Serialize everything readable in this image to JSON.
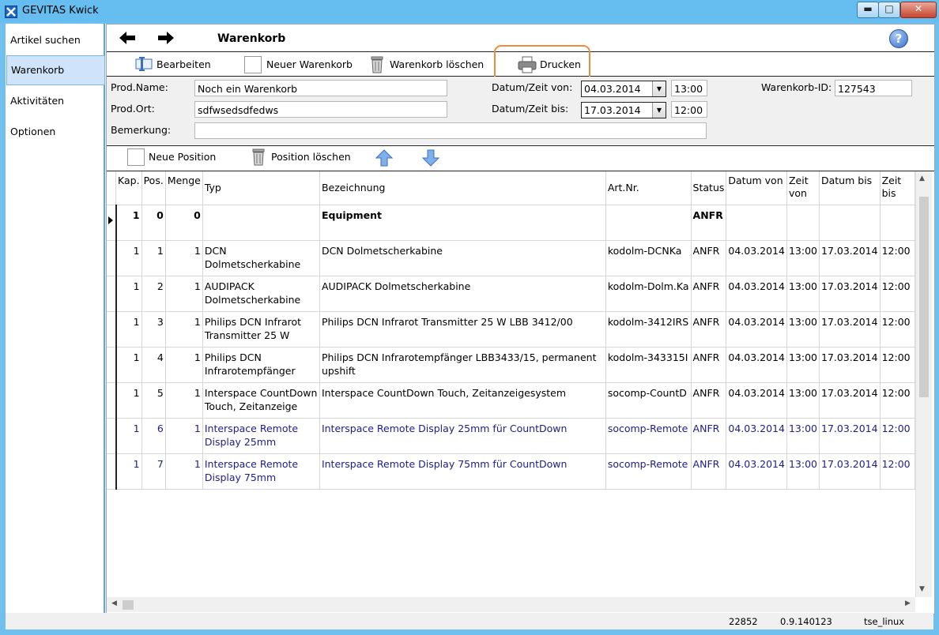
{
  "window": {
    "title": "GEVITAS Kwick",
    "min": "▬",
    "max": "□",
    "close": "✕"
  },
  "sidebar": {
    "items": [
      {
        "label": "Artikel suchen"
      },
      {
        "label": "Warenkorb"
      },
      {
        "label": "Aktivitäten"
      },
      {
        "label": "Optionen"
      }
    ]
  },
  "nav": {
    "back": "🡄",
    "forward": "🡆",
    "title": "Warenkorb",
    "help": "?"
  },
  "toolbar": {
    "edit": "Bearbeiten",
    "new_cart": "Neuer Warenkorb",
    "delete_cart": "Warenkorb löschen",
    "print": "Drucken"
  },
  "form": {
    "prod_name_label": "Prod.Name:",
    "prod_name_value": "Noch ein Warenkorb",
    "prod_ort_label": "Prod.Ort:",
    "prod_ort_value": "sdfwsedsdfedws",
    "bemerkung_label": "Bemerkung:",
    "bemerkung_value": "",
    "datum_von_label": "Datum/Zeit von:",
    "datum_von_value": "04.03.2014",
    "zeit_von_value": "13:00",
    "datum_bis_label": "Datum/Zeit bis:",
    "datum_bis_value": "17.03.2014",
    "zeit_bis_value": "12:00",
    "warenkorb_id_label": "Warenkorb-ID:",
    "warenkorb_id_value": "127543"
  },
  "positions_toolbar": {
    "new": "Neue Position",
    "delete": "Position löschen"
  },
  "table": {
    "columns": [
      "Kap.",
      "Pos.",
      "Menge",
      "Typ",
      "Bezeichnung",
      "Art.Nr.",
      "Status",
      "Datum von",
      "Zeit von",
      "Datum bis",
      "Zeit bis"
    ],
    "rows": [
      {
        "kap": "1",
        "pos": "0",
        "menge": "0",
        "typ": "",
        "bez": "Equipment",
        "art": "",
        "status": "ANFR",
        "dvon": "",
        "zvon": "",
        "dbis": "",
        "zbis": "",
        "style": "bold"
      },
      {
        "kap": "1",
        "pos": "1",
        "menge": "1",
        "typ": "DCN Dolmetscherkabine",
        "bez": "DCN Dolmetscherkabine",
        "art": "kodolm-DCNKa",
        "status": "ANFR",
        "dvon": "04.03.2014",
        "zvon": "13:00",
        "dbis": "17.03.2014",
        "zbis": "12:00",
        "style": ""
      },
      {
        "kap": "1",
        "pos": "2",
        "menge": "1",
        "typ": "AUDIPACK Dolmetscherkabine",
        "bez": "AUDIPACK Dolmetscherkabine",
        "art": "kodolm-Dolm.Ka",
        "status": "ANFR",
        "dvon": "04.03.2014",
        "zvon": "13:00",
        "dbis": "17.03.2014",
        "zbis": "12:00",
        "style": ""
      },
      {
        "kap": "1",
        "pos": "3",
        "menge": "1",
        "typ": "Philips DCN Infrarot Transmitter 25 W",
        "bez": "Philips DCN Infrarot Transmitter 25 W LBB 3412/00",
        "art": "kodolm-3412IRS",
        "status": "ANFR",
        "dvon": "04.03.2014",
        "zvon": "13:00",
        "dbis": "17.03.2014",
        "zbis": "12:00",
        "style": ""
      },
      {
        "kap": "1",
        "pos": "4",
        "menge": "1",
        "typ": "Philips DCN Infrarotempfänger",
        "bez": "Philips DCN Infrarotempfänger LBB3433/15, permanent upshift",
        "art": "kodolm-343315I",
        "status": "ANFR",
        "dvon": "04.03.2014",
        "zvon": "13:00",
        "dbis": "17.03.2014",
        "zbis": "12:00",
        "style": ""
      },
      {
        "kap": "1",
        "pos": "5",
        "menge": "1",
        "typ": "Interspace CountDown Touch, Zeitanzeige",
        "bez": "Interspace CountDown Touch, Zeitanzeigesystem",
        "art": "socomp-CountD",
        "status": "ANFR",
        "dvon": "04.03.2014",
        "zvon": "13:00",
        "dbis": "17.03.2014",
        "zbis": "12:00",
        "style": ""
      },
      {
        "kap": "1",
        "pos": "6",
        "menge": "1",
        "typ": "Interspace Remote Display 25mm",
        "bez": "Interspace Remote Display 25mm für CountDown",
        "art": "socomp-Remote",
        "status": "ANFR",
        "dvon": "04.03.2014",
        "zvon": "13:00",
        "dbis": "17.03.2014",
        "zbis": "12:00",
        "style": "blue"
      },
      {
        "kap": "1",
        "pos": "7",
        "menge": "1",
        "typ": "Interspace Remote Display 75mm",
        "bez": "Interspace Remote Display 75mm für CountDown",
        "art": "socomp-Remote",
        "status": "ANFR",
        "dvon": "04.03.2014",
        "zvon": "13:00",
        "dbis": "17.03.2014",
        "zbis": "12:00",
        "style": "blue"
      }
    ]
  },
  "status": {
    "count": "22852",
    "version": "0.9.140123",
    "host": "tse_linux"
  },
  "icons": {
    "back": "arrow-left-icon",
    "forward": "arrow-right-icon",
    "help": "help-icon",
    "edit": "edit-icon",
    "new_cart": "blank-document-icon",
    "delete_cart": "trash-icon",
    "print": "printer-icon",
    "up": "arrow-up-icon",
    "down": "arrow-down-icon"
  },
  "colors": {
    "titlebar": "#66bdf0",
    "highlight": "#f08b3a",
    "blue_row": "#1d1d8c",
    "sidebar_active": "#cfe4fb"
  }
}
